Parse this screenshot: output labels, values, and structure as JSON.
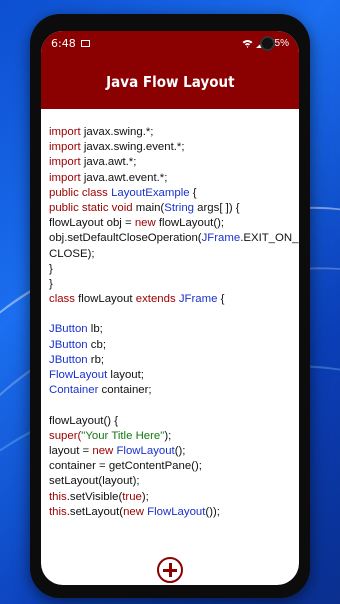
{
  "status_bar": {
    "time": "6:48",
    "battery": "75%"
  },
  "app_bar": {
    "title": "Java Flow Layout"
  },
  "code": {
    "l1": "javax.swing.*;",
    "l2": "javax.swing.event.*;",
    "l3": "java.awt.*;",
    "l4": "java.awt.event.*;",
    "l5a": "public class",
    "l5b": "LayoutExample",
    "l5c": " {",
    "l6a": "public static void",
    "l6b": " main(",
    "l6c": "String",
    "l6d": " args[ ]) {",
    "l7a": "flowLayout obj = ",
    "l7b": "new",
    "l7c": " flowLayout();",
    "l8a": "obj.setDefaultCloseOperation(",
    "l8b": "JFrame",
    "l8c": ".EXIT_ON_",
    "l9": "CLOSE);",
    "l10": "}",
    "l11": "}",
    "l12a": "class",
    "l12b": " flowLayout ",
    "l12c": "extends",
    "l12d": "JFrame",
    "l12e": " {",
    "l14a": "JButton",
    "l14b": " lb;",
    "l15a": "JButton",
    "l15b": " cb;",
    "l16a": "JButton",
    "l16b": " rb;",
    "l17a": "FlowLayout",
    "l17b": " layout;",
    "l18a": "Container",
    "l18b": " container;",
    "l20": "flowLayout() {",
    "l21a": "super(",
    "l21b": "\"Your Title Here\"",
    "l21c": ");",
    "l22a": "layout = ",
    "l22b": "new",
    "l22c": "FlowLayout",
    "l22d": "();",
    "l23": "container = getContentPane();",
    "l24": "setLayout(layout);",
    "l25a": "this",
    "l25b": ".setVisible(",
    "l25c": "true",
    "l25d": ");",
    "l26a": "this",
    "l26b": ".setLayout(",
    "l26c": "new",
    "l26d": "FlowLayout",
    "l26e": "());",
    "import_kw": "import"
  },
  "colors": {
    "primary": "#8b0000",
    "keyword": "#9a0000",
    "type": "#1a33cc",
    "string": "#137a13"
  },
  "icons": {
    "fab": "plus-circle-icon"
  }
}
